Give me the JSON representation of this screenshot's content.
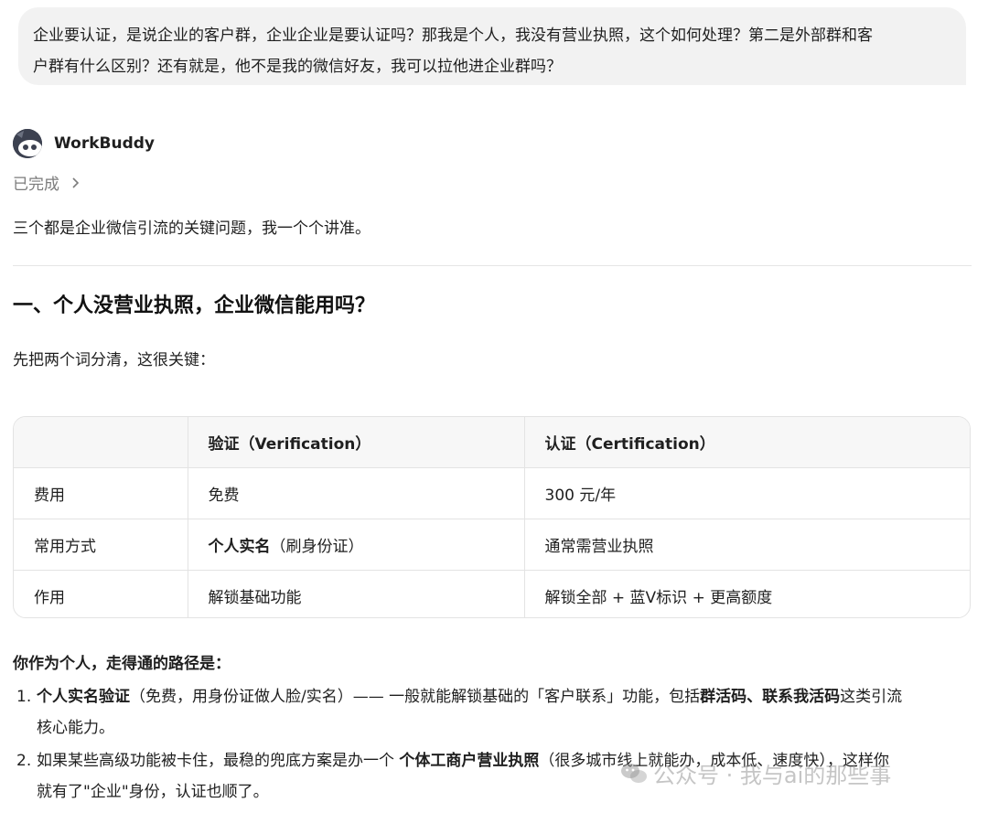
{
  "user_message": {
    "line1": "企业要认证，是说企业的客户群，企业企业是要认证吗？那我是个人，我没有营业执照，这个如何处理？第二是外部群和客",
    "line2": "户群有什么区别？还有就是，他不是我的微信好友，我可以拉他进企业群吗？"
  },
  "assistant": {
    "name": "WorkBuddy",
    "status": "已完成",
    "intro": "三个都是企业微信引流的关键问题，我一个个讲准。",
    "section_title": "一、个人没营业执照，企业微信能用吗？",
    "lead": "先把两个词分清，这很关键："
  },
  "table": {
    "headers": [
      "",
      "验证（Verification）",
      "认证（Certification）"
    ],
    "rows": [
      {
        "label": "费用",
        "verification": "免费",
        "certification": "300 元/年"
      },
      {
        "label": "常用方式",
        "verification_bold": "个人实名",
        "verification_rest": "（刷身份证）",
        "certification": "通常需营业执照"
      },
      {
        "label": "作用",
        "verification": "解锁基础功能",
        "certification": "解锁全部 + 蓝V标识 + 更高额度"
      }
    ]
  },
  "path": {
    "title": "你作为个人，走得通的路径是：",
    "steps": [
      {
        "num": "1.",
        "bold1": "个人实名验证",
        "text1": "（免费，用身份证做人脸/实名）—— 一般就能解锁基础的「客户联系」功能，包括",
        "bold2": "群活码",
        "sep": "、",
        "bold3": "联系我活码",
        "text2": "这类引流",
        "line2": "核心能力。"
      },
      {
        "num": "2.",
        "text1": "如果某些高级功能被卡住，最稳的兜底方案是办一个 ",
        "bold1": "个体工商户营业执照",
        "text2": "（很多城市线上就能办，成本低、速度快），这样你",
        "line2": "就有了\"企业\"身份，认证也顺了。"
      }
    ]
  },
  "watermark": {
    "text": "公众号 · 我与ai的那些事"
  }
}
